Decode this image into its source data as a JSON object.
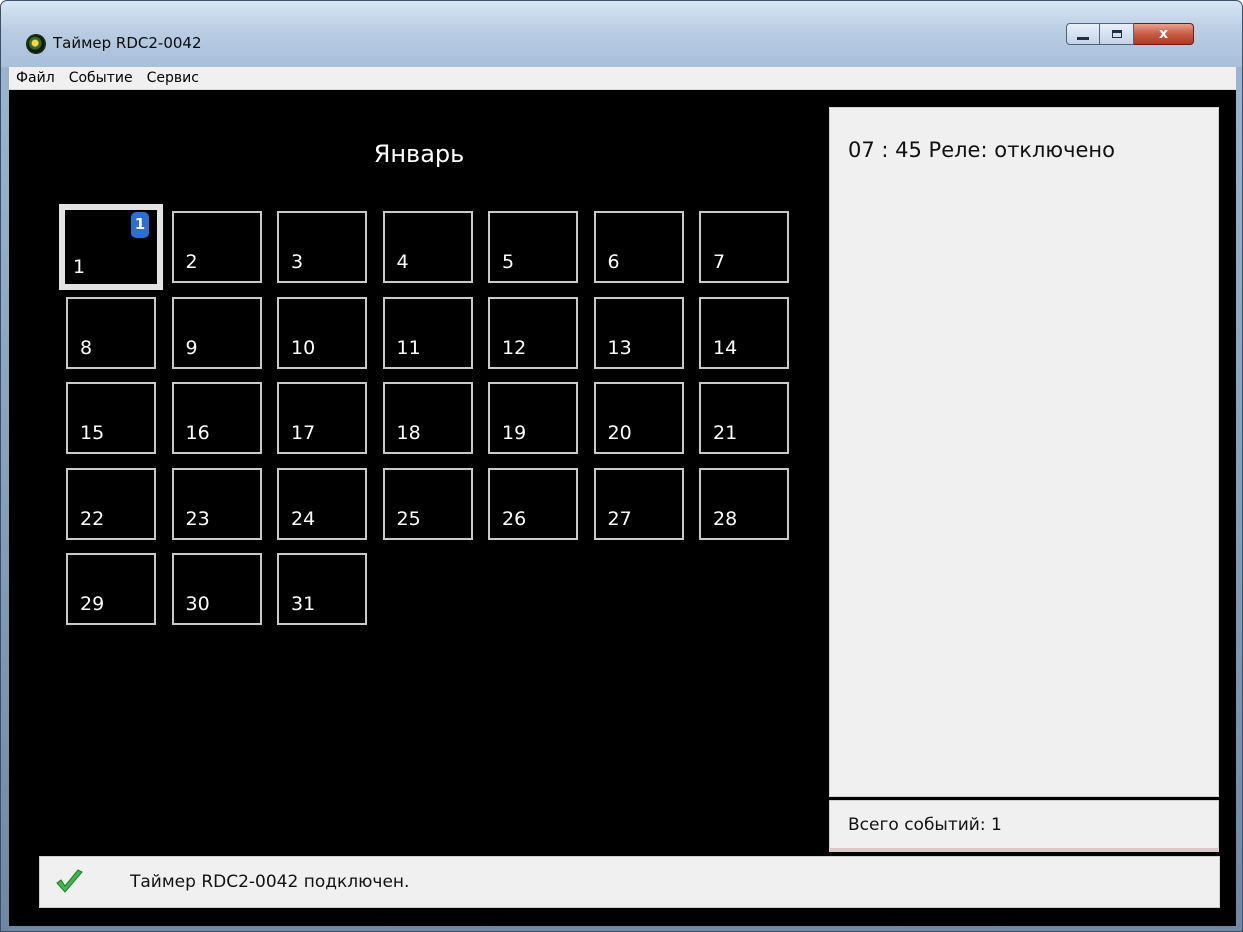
{
  "window": {
    "title": "Таймер RDC2-0042",
    "icon": "app-timer-icon",
    "controls": {
      "minimize": "minimize-icon",
      "maximize": "maximize-icon",
      "close_label": "x"
    }
  },
  "menu": [
    "Файл",
    "Событие",
    "Сервис"
  ],
  "calendar": {
    "month": "Январь",
    "days": [
      "1",
      "2",
      "3",
      "4",
      "5",
      "6",
      "7",
      "8",
      "9",
      "10",
      "11",
      "12",
      "13",
      "14",
      "15",
      "16",
      "17",
      "18",
      "19",
      "20",
      "21",
      "22",
      "23",
      "24",
      "25",
      "26",
      "27",
      "28",
      "29",
      "30",
      "31"
    ],
    "selected_day": "1",
    "badge_count": "1"
  },
  "events_panel": {
    "entry": "07 : 45  Реле: отключено",
    "total": "Всего событий: 1"
  },
  "status": {
    "icon": "check-icon",
    "text": "Таймер RDC2-0042 подключен."
  },
  "colors": {
    "badge": "#2b6fd0",
    "check": "#3db84a",
    "calendar_bg": "#000000"
  }
}
